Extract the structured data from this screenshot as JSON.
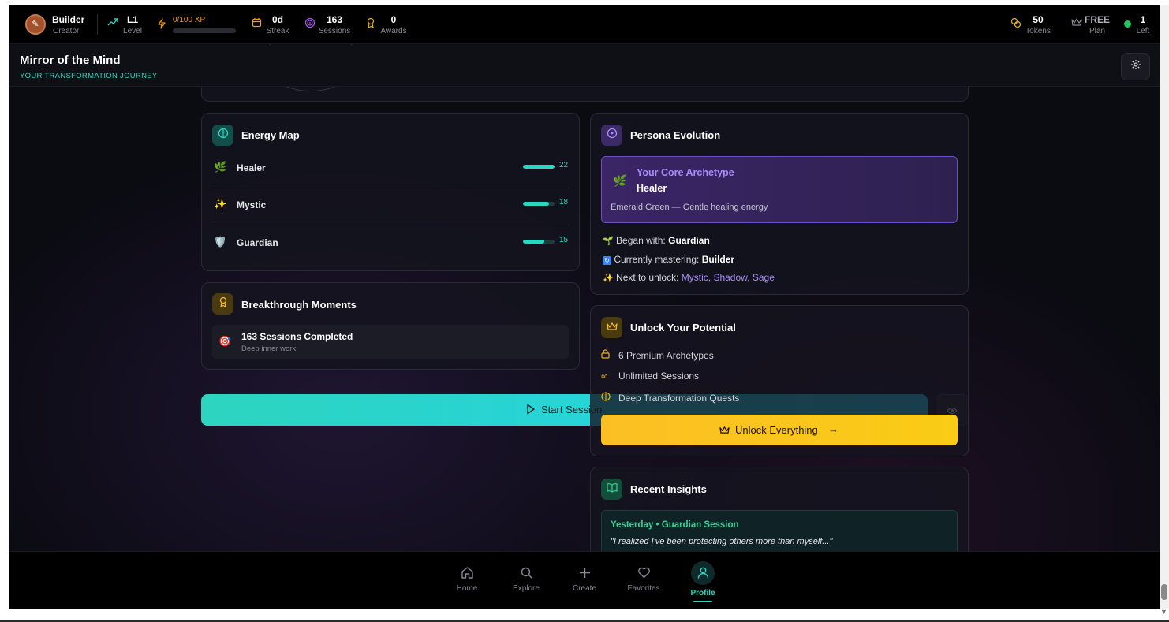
{
  "topbar": {
    "user_name": "Builder",
    "user_role": "Creator",
    "level": {
      "value": "L1",
      "label": "Level"
    },
    "xp": {
      "text": "0/100 XP",
      "progress": 0
    },
    "streak": {
      "value": "0d",
      "label": "Streak"
    },
    "sessions": {
      "value": "163",
      "label": "Sessions"
    },
    "awards": {
      "value": "0",
      "label": "Awards"
    },
    "tokens": {
      "value": "50",
      "label": "Tokens"
    },
    "plan": {
      "value": "FREE",
      "label": "Plan"
    },
    "left": {
      "value": "1",
      "label": "Left"
    }
  },
  "header": {
    "title": "Mirror of the Mind",
    "subtitle": "YOUR TRANSFORMATION JOURNEY"
  },
  "energy_map": {
    "title": "Energy Map",
    "items": [
      {
        "name": "Healer",
        "value": "22",
        "fraction": 1.0
      },
      {
        "name": "Mystic",
        "value": "18",
        "fraction": 0.82
      },
      {
        "name": "Guardian",
        "value": "15",
        "fraction": 0.68
      }
    ]
  },
  "breakthrough": {
    "title": "Breakthrough Moments",
    "item_title": "163 Sessions Completed",
    "item_sub": "Deep inner work"
  },
  "persona": {
    "title": "Persona Evolution",
    "core_label": "Your Core Archetype",
    "core_name": "Healer",
    "core_desc": "Emerald Green — Gentle healing energy",
    "began_label": "Began with:",
    "began_value": "Guardian",
    "mastering_label": "Currently mastering:",
    "mastering_value": "Builder",
    "next_label": "Next to unlock:",
    "next_values": [
      "Mystic",
      "Shadow",
      "Sage"
    ]
  },
  "unlock": {
    "title": "Unlock Your Potential",
    "items": [
      "6 Premium Archetypes",
      "Unlimited Sessions",
      "Deep Transformation Quests"
    ],
    "button": "Unlock Everything"
  },
  "start_session": {
    "label": "Start Session"
  },
  "insights": {
    "title": "Recent Insights",
    "meta": "Yesterday • Guardian Session",
    "quote": "\"I realized I've been protecting others more than myself...\""
  },
  "bottom_nav": [
    {
      "label": "Home",
      "icon": "home-icon"
    },
    {
      "label": "Explore",
      "icon": "search-icon"
    },
    {
      "label": "Create",
      "icon": "plus-icon"
    },
    {
      "label": "Favorites",
      "icon": "heart-icon"
    },
    {
      "label": "Profile",
      "icon": "user-icon",
      "active": true
    }
  ],
  "colors": {
    "accent": "#2dd4bf",
    "gold": "#fbbf24",
    "purple": "#a78bfa",
    "xp": "#f59e0b",
    "online": "#22c55e"
  }
}
